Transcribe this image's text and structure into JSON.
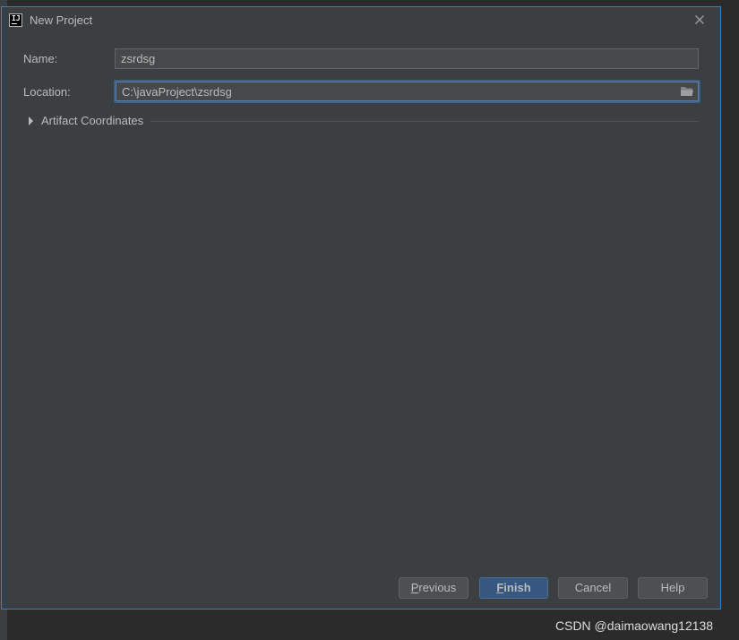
{
  "window": {
    "title": "New Project",
    "app_icon_text": "IJ"
  },
  "form": {
    "name_label": "Name:",
    "name_value": "zsrdsg",
    "location_label": "Location:",
    "location_value": "C:\\javaProject\\zsrdsg",
    "artifact_label": "Artifact Coordinates"
  },
  "buttons": {
    "previous_first": "P",
    "previous_rest": "revious",
    "finish_first": "F",
    "finish_rest": "inish",
    "cancel": "Cancel",
    "help": "Help"
  },
  "watermark": {
    "text": "CSDN @daimaowang12138"
  },
  "icons": {
    "app": "intellij-icon",
    "close": "close-icon",
    "folder": "folder-icon",
    "expand": "triangle-right-icon"
  },
  "colors": {
    "background": "#3c3f41",
    "field": "#45494a",
    "focus_border": "#3d7fc4",
    "default_button": "#365880",
    "button": "#4c5052",
    "text": "#bbbbbb"
  }
}
